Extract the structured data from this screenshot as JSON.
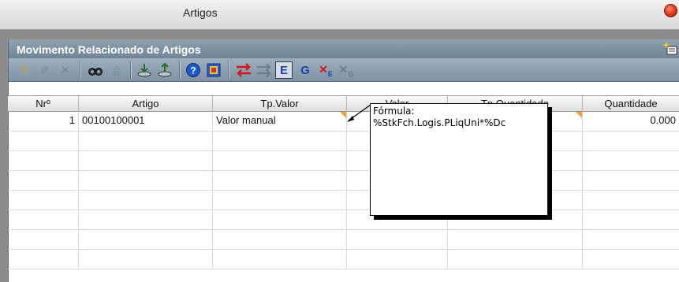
{
  "window": {
    "title": "Artigos"
  },
  "panel": {
    "title": "Movimento Relacionado de Artigos"
  },
  "toolbar": {
    "buttons": [
      {
        "name": "new-record-icon",
        "glyph": "✎",
        "color": "#c9a23a",
        "disabled": false
      },
      {
        "name": "edit-icon",
        "glyph": "✐",
        "color": "#6a7a88",
        "disabled": true
      },
      {
        "name": "delete-icon",
        "glyph": "✕",
        "color": "#6a7a88",
        "disabled": true
      },
      {
        "name": "find-icon",
        "glyph": "🔍",
        "color": "#222",
        "disabled": false
      },
      {
        "name": "print-icon",
        "glyph": "⎙",
        "color": "#6a7a88",
        "disabled": true
      },
      {
        "name": "import-icon",
        "glyph": "⇩",
        "color": "#3a6a3a",
        "disabled": false
      },
      {
        "name": "export-icon",
        "glyph": "⇧",
        "color": "#3a6a3a",
        "disabled": false
      },
      {
        "name": "help-icon",
        "glyph": "?",
        "color": "#1d58c8",
        "disabled": false
      },
      {
        "name": "report-icon",
        "glyph": "▦",
        "color": "#1d58c8",
        "disabled": false
      },
      {
        "name": "transfer-red-icon",
        "glyph": "⇆",
        "color": "#d01818",
        "disabled": false
      },
      {
        "name": "transfer-gray-icon",
        "glyph": "⇄",
        "color": "#6a7a88",
        "disabled": true
      },
      {
        "name": "e-button-icon",
        "glyph": "E",
        "color": "#1d3fb0",
        "disabled": false
      },
      {
        "name": "g-button-icon",
        "glyph": "G",
        "color": "#1d3fb0",
        "disabled": false
      },
      {
        "name": "xe-button-icon",
        "glyph": "✕E",
        "color": "#d01818",
        "disabled": false
      },
      {
        "name": "xg-button-icon",
        "glyph": "✕G",
        "color": "#6a7a88",
        "disabled": true
      }
    ]
  },
  "table": {
    "columns": [
      "Nrº",
      "Artigo",
      "Tp.Valor",
      "Valor",
      "Tp.Quantidade",
      "Quantidade"
    ],
    "rows": [
      {
        "nr": "1",
        "artigo": "00100100001",
        "tp_valor": "Valor manual",
        "valor": "",
        "tp_quantidade": "",
        "quantidade": "0.000"
      }
    ]
  },
  "tooltip": {
    "line1": "Fórmula:",
    "line2": "%StkFch.Logis.PLiqUni*%Dc"
  },
  "colors": {
    "header_bar": "#6f8496",
    "cell_marker": "#e8a33a"
  }
}
